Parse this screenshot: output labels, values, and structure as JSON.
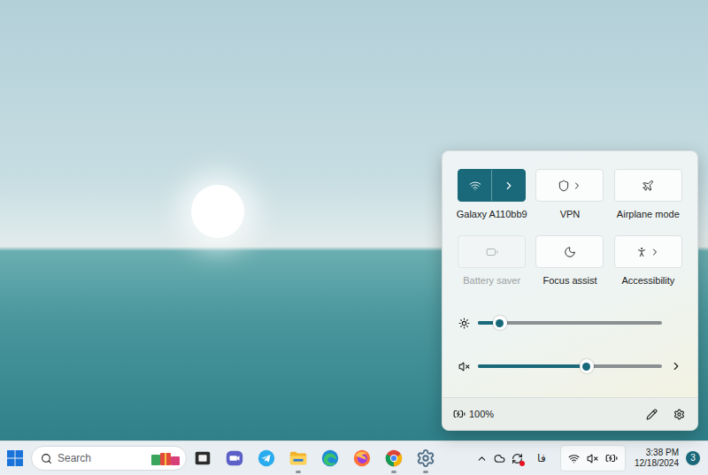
{
  "quick_settings": {
    "tiles": [
      {
        "kind": "wifi",
        "label": "Galaxy A110bb9",
        "on": true,
        "disabled": false,
        "expandable": true
      },
      {
        "kind": "vpn",
        "label": "VPN",
        "on": false,
        "disabled": false,
        "expandable": true
      },
      {
        "kind": "airplane",
        "label": "Airplane mode",
        "on": false,
        "disabled": false,
        "expandable": false
      },
      {
        "kind": "battery-saver",
        "label": "Battery saver",
        "on": false,
        "disabled": true,
        "expandable": false
      },
      {
        "kind": "focus",
        "label": "Focus assist",
        "on": false,
        "disabled": false,
        "expandable": false
      },
      {
        "kind": "accessibility",
        "label": "Accessibility",
        "on": false,
        "disabled": false,
        "expandable": true
      }
    ],
    "brightness": {
      "level": 0.12
    },
    "volume": {
      "level": 0.59,
      "muted": true,
      "expandable": true
    },
    "battery": {
      "reading": "100%",
      "charging": true
    }
  },
  "taskbar": {
    "search": {
      "placeholder": "Search"
    },
    "apps": [
      {
        "kind": "task-view",
        "running": false
      },
      {
        "kind": "teams",
        "running": false
      },
      {
        "kind": "telegram",
        "running": false
      },
      {
        "kind": "file-explorer",
        "running": true
      },
      {
        "kind": "edge",
        "running": false
      },
      {
        "kind": "firefox",
        "running": false
      },
      {
        "kind": "chrome",
        "running": true
      },
      {
        "kind": "settings",
        "running": true
      }
    ],
    "tray": {
      "language": "فا",
      "time": "3:38 PM",
      "date": "12/18/2024",
      "notifications": "3"
    }
  }
}
